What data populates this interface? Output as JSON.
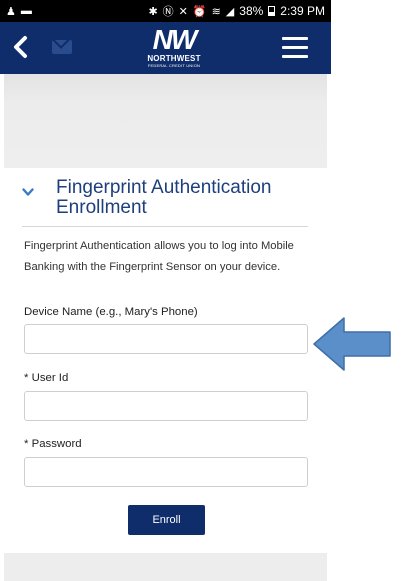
{
  "status_bar": {
    "battery_percent": "38%",
    "time": "2:39 PM"
  },
  "header": {
    "logo_mark": "NW",
    "logo_name": "NORTHWEST",
    "logo_sub": "FEDERAL CREDIT UNION"
  },
  "section": {
    "title": "Fingerprint Authentication Enrollment",
    "description": "Fingerprint Authentication allows you to log into Mobile Banking with the Fingerprint Sensor on your device."
  },
  "form": {
    "device_name_label": "Device Name (e.g., Mary's Phone)",
    "device_name_value": "",
    "user_id_label": "* User Id",
    "user_id_value": "",
    "password_label": "* Password",
    "password_value": "",
    "enroll_label": "Enroll"
  },
  "colors": {
    "brand_navy": "#0f2d6b",
    "title_blue": "#1d3f7d",
    "arrow_blue": "#5b8fc9"
  }
}
